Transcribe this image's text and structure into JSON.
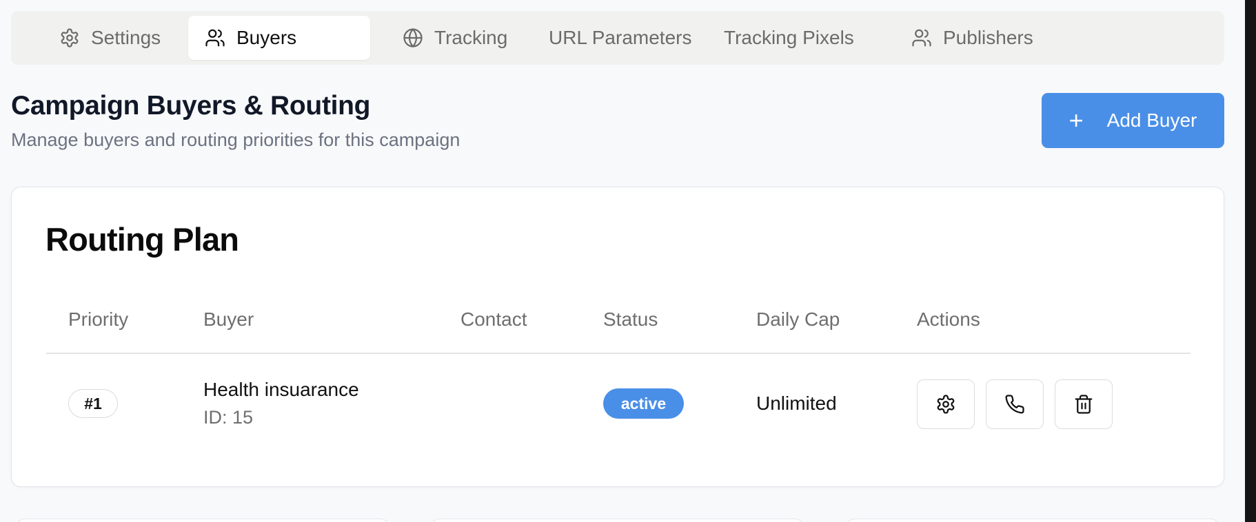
{
  "tabs": [
    {
      "label": "Settings",
      "icon": "gear-icon",
      "active": false
    },
    {
      "label": "Buyers",
      "icon": "users-icon",
      "active": true
    },
    {
      "label": "Tracking",
      "icon": "globe-icon",
      "active": false
    },
    {
      "label": "URL Parameters",
      "icon": "",
      "active": false
    },
    {
      "label": "Tracking Pixels",
      "icon": "",
      "active": false
    },
    {
      "label": "Publishers",
      "icon": "users-icon",
      "active": false
    }
  ],
  "header": {
    "title": "Campaign Buyers & Routing",
    "subtitle": "Manage buyers and routing priorities for this campaign",
    "add_button_label": "Add Buyer",
    "add_button_icon": "plus-icon"
  },
  "routing_plan": {
    "title": "Routing Plan",
    "columns": [
      "Priority",
      "Buyer",
      "Contact",
      "Status",
      "Daily Cap",
      "Actions"
    ],
    "rows": [
      {
        "priority": "#1",
        "buyer_name": "Health insuarance",
        "buyer_id": "ID: 15",
        "contact": "",
        "status": "active",
        "daily_cap": "Unlimited",
        "actions": [
          "gear-icon",
          "phone-icon",
          "trash-icon"
        ]
      }
    ]
  },
  "colors": {
    "accent": "#4a8fe7",
    "page_bg": "#f8f9fb",
    "tabbar_bg": "#f1f1ef",
    "muted_text": "#6b7280"
  }
}
